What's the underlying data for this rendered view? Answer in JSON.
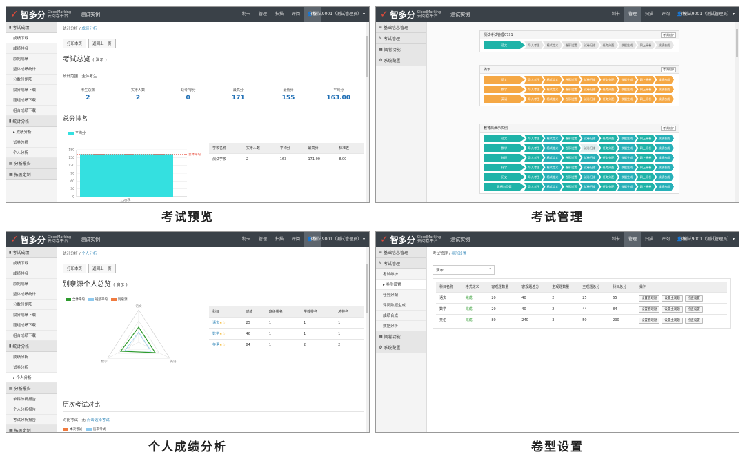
{
  "app": {
    "logo_main": "智多分",
    "logo_sub_en": "CloudMarking",
    "logo_sub_cn": "云阅卷平台",
    "site_name": "测试实例",
    "user": "测试9001（测试管理员）",
    "nav": [
      "制卡",
      "管理",
      "扫描",
      "评阅",
      "分析"
    ]
  },
  "captions": {
    "p1": "考试预览",
    "p2": "考试管理",
    "p3": "个人成绩分析",
    "p4": "卷型设置"
  },
  "colors": {
    "topbar": "#3a4148",
    "accent_blue": "#1f6fb5",
    "bar_cyan": "#34e0e0",
    "pipe_teal": "#1fb3a8",
    "pipe_orange": "#f5a845",
    "green_status": "#2d9a2d"
  },
  "p1": {
    "sidebar": [
      {
        "type": "group",
        "label": "考试成绩",
        "icon": "bar-chart-icon"
      },
      {
        "type": "item",
        "label": "成绩下载",
        "current": true
      },
      {
        "type": "item",
        "label": "成绩排名"
      },
      {
        "type": "item",
        "label": "原始成绩"
      },
      {
        "type": "item",
        "label": "整体成绩统计"
      },
      {
        "type": "item",
        "label": "分数段矩阵"
      },
      {
        "type": "item",
        "label": "赋分成绩下载"
      },
      {
        "type": "item",
        "label": "题组成绩下载"
      },
      {
        "type": "item",
        "label": "组合成绩下载"
      },
      {
        "type": "group",
        "label": "统计分析",
        "icon": "bar-chart-icon"
      },
      {
        "type": "item",
        "label": "▸ 成绩分析"
      },
      {
        "type": "item",
        "label": "试卷分析"
      },
      {
        "type": "item",
        "label": "个人分析"
      },
      {
        "type": "group",
        "label": "分析报告",
        "icon": "doc-icon"
      },
      {
        "type": "group",
        "label": "拓展定制",
        "icon": "calendar-icon"
      }
    ],
    "crumb": [
      "统计分析",
      "成绩分析"
    ],
    "buttons": [
      "打印本页",
      "返回上一页"
    ],
    "title": "考试总览",
    "title_tag": "( 演示 )",
    "scope": "统计范围：全体考生",
    "stats": [
      {
        "label": "考生总数",
        "value": "2"
      },
      {
        "label": "实考人数",
        "value": "2"
      },
      {
        "label": "缺考/零分",
        "value": "0"
      },
      {
        "label": "最高分",
        "value": "171"
      },
      {
        "label": "最低分",
        "value": "155"
      },
      {
        "label": "平均分",
        "value": "163.00"
      }
    ],
    "section": "总分排名",
    "legend": "平均分",
    "avg_label": "总体平均",
    "table_headers": [
      "学校名称",
      "实考人数",
      "平均分",
      "最高分",
      "标准差"
    ],
    "table_rows": [
      [
        "测试学校",
        "2",
        "163",
        "171.00",
        "8.00"
      ]
    ],
    "chart_data": {
      "type": "bar",
      "categories": [
        "测试学校"
      ],
      "series": [
        {
          "name": "平均分",
          "values": [
            163
          ]
        }
      ],
      "ylim": [
        0,
        180
      ],
      "yticks": [
        0,
        30,
        60,
        90,
        120,
        150,
        180
      ],
      "reference_line": {
        "label": "总体平均",
        "value": 163
      }
    }
  },
  "p2": {
    "sidebar": [
      {
        "type": "group",
        "label": "基础信息管理",
        "icon": "list-icon"
      },
      {
        "type": "group",
        "label": "考试管理",
        "icon": "edit-icon"
      },
      {
        "type": "group",
        "label": "阅卷功能",
        "icon": "grid-icon"
      },
      {
        "type": "group",
        "label": "系统配置",
        "icon": "gear-icon"
      }
    ],
    "cards": [
      {
        "title": "测试考试管理0731",
        "btn": "考试维护",
        "rows": [
          {
            "subject": "语文",
            "style": "t",
            "steps": [
              "导入考生",
              "格式定义",
              "卷形设置",
              "试卷扫描",
              "任务分配",
              "数据生成",
              "网上阅卷",
              "成绩合成"
            ],
            "stepstyle": "g"
          }
        ]
      },
      {
        "title": "演示",
        "btn": "考试维护",
        "rows": [
          {
            "subject": "语文",
            "style": "o",
            "steps": [
              "导入考生",
              "格式定义",
              "卷形设置",
              "试卷扫描",
              "任务分配",
              "数据生成",
              "网上阅卷",
              "成绩合成"
            ],
            "stepstyle": "o"
          },
          {
            "subject": "数学",
            "style": "o",
            "steps": [
              "导入考生",
              "格式定义",
              "卷形设置",
              "试卷扫描",
              "任务分配",
              "数据生成",
              "网上阅卷",
              "成绩合成"
            ],
            "stepstyle": "o"
          },
          {
            "subject": "英语",
            "style": "o",
            "steps": [
              "导入考生",
              "格式定义",
              "卷形设置",
              "试卷扫描",
              "任务分配",
              "数据生成",
              "网上阅卷",
              "成绩合成"
            ],
            "stepstyle": "o"
          }
        ]
      },
      {
        "title": "教育局演示实例",
        "btn": "考试维护",
        "rows": [
          {
            "subject": "语文",
            "style": "t",
            "steps": [
              "导入考生",
              "格式定义",
              "卷形设置",
              "试卷扫描",
              "任务分配",
              "数据生成",
              "网上阅卷",
              "成绩合成"
            ],
            "stepstyle": "t"
          },
          {
            "subject": "数学",
            "style": "t",
            "steps": [
              "导入考生",
              "格式定义",
              "卷形设置",
              "试卷扫描",
              "任务分配",
              "数据生成",
              "网上阅卷",
              "成绩合成"
            ],
            "stepstyle": "mixed"
          },
          {
            "subject": "物理",
            "style": "t",
            "steps": [
              "导入考生",
              "格式定义",
              "卷形设置",
              "试卷扫描",
              "任务分配",
              "数据生成",
              "网上阅卷",
              "成绩合成"
            ],
            "stepstyle": "t"
          },
          {
            "subject": "化学",
            "style": "t",
            "steps": [
              "导入考生",
              "格式定义",
              "卷形设置",
              "试卷扫描",
              "任务分配",
              "数据生成",
              "网上阅卷",
              "成绩合成"
            ],
            "stepstyle": "t"
          },
          {
            "subject": "历史",
            "style": "t",
            "steps": [
              "导入考生",
              "格式定义",
              "卷形设置",
              "试卷扫描",
              "任务分配",
              "数据生成",
              "网上阅卷",
              "成绩合成"
            ],
            "stepstyle": "t"
          },
          {
            "subject": "思想与品德",
            "style": "t",
            "steps": [
              "导入考生",
              "格式定义",
              "卷形设置",
              "试卷扫描",
              "任务分配",
              "数据生成",
              "网上阅卷",
              "成绩合成"
            ],
            "stepstyle": "t"
          }
        ]
      }
    ]
  },
  "p3": {
    "sidebar": [
      {
        "type": "group",
        "label": "考试成绩",
        "icon": "bar-chart-icon"
      },
      {
        "type": "item",
        "label": "成绩下载"
      },
      {
        "type": "item",
        "label": "成绩排名"
      },
      {
        "type": "item",
        "label": "原始成绩"
      },
      {
        "type": "item",
        "label": "整体成绩统计"
      },
      {
        "type": "item",
        "label": "分数段矩阵"
      },
      {
        "type": "item",
        "label": "赋分成绩下载"
      },
      {
        "type": "item",
        "label": "题组成绩下载"
      },
      {
        "type": "item",
        "label": "组合成绩下载"
      },
      {
        "type": "group",
        "label": "统计分析",
        "icon": "bar-chart-icon"
      },
      {
        "type": "item",
        "label": "成绩分析"
      },
      {
        "type": "item",
        "label": "试卷分析"
      },
      {
        "type": "item",
        "label": "▸ 个人分析",
        "current": true
      },
      {
        "type": "group",
        "label": "分析报告",
        "icon": "doc-icon"
      },
      {
        "type": "item",
        "label": "单科分析报告"
      },
      {
        "type": "item",
        "label": "个人分析报告"
      },
      {
        "type": "item",
        "label": "考试分析报告"
      },
      {
        "type": "group",
        "label": "拓展定制",
        "icon": "calendar-icon"
      }
    ],
    "crumb": [
      "统计分析",
      "个人分析"
    ],
    "buttons": [
      "打印本页",
      "返回上一页"
    ],
    "title": "别泉源个人总览",
    "title_tag": "( 演示 )",
    "radar_legend": [
      "全体平均",
      "班级平均",
      "别泉源"
    ],
    "radar_axes": [
      "语文",
      "数学",
      "英语"
    ],
    "table_headers": [
      "科目",
      "成绩",
      "班级排名",
      "学校排名",
      "总排名"
    ],
    "table_rows": [
      [
        "语文",
        "25",
        "1",
        "1",
        "1"
      ],
      [
        "数学",
        "46",
        "1",
        "1",
        "1"
      ],
      [
        "英语",
        "84",
        "1",
        "2",
        "2"
      ]
    ],
    "history_title": "历次考试对比",
    "history_compare_label": "对比考试：无",
    "history_compare_link": "点击选择考试",
    "history_legend": [
      "本次考试",
      "历次考试"
    ]
  },
  "p4": {
    "sidebar": [
      {
        "type": "group",
        "label": "基础信息管理",
        "icon": "list-icon"
      },
      {
        "type": "group",
        "label": "考试管理",
        "icon": "edit-icon"
      },
      {
        "type": "item",
        "label": "考试维护"
      },
      {
        "type": "item",
        "label": "▸ 卷形设置",
        "current": true
      },
      {
        "type": "item",
        "label": "任务分配"
      },
      {
        "type": "item",
        "label": "评阅数据生成"
      },
      {
        "type": "item",
        "label": "成绩合成"
      },
      {
        "type": "item",
        "label": "数据分析"
      },
      {
        "type": "group",
        "label": "阅卷功能",
        "icon": "grid-icon"
      },
      {
        "type": "group",
        "label": "系统配置",
        "icon": "gear-icon"
      }
    ],
    "crumb": [
      "考试管理",
      "卷形设置"
    ],
    "select_value": "演示",
    "table_headers": [
      "科目名称",
      "格式定义",
      "客观题数量",
      "客观题总分",
      "主观题数量",
      "主观题总分",
      "科目总分",
      "操作"
    ],
    "table_rows": [
      [
        "语文",
        "完成",
        "20",
        "40",
        "2",
        "25",
        "65"
      ],
      [
        "数学",
        "完成",
        "20",
        "40",
        "2",
        "44",
        "84"
      ],
      [
        "英语",
        "完成",
        "80",
        "240",
        "3",
        "50",
        "290"
      ]
    ],
    "op_buttons": [
      "设置客观题",
      "设置主观题",
      "检查设置"
    ]
  }
}
